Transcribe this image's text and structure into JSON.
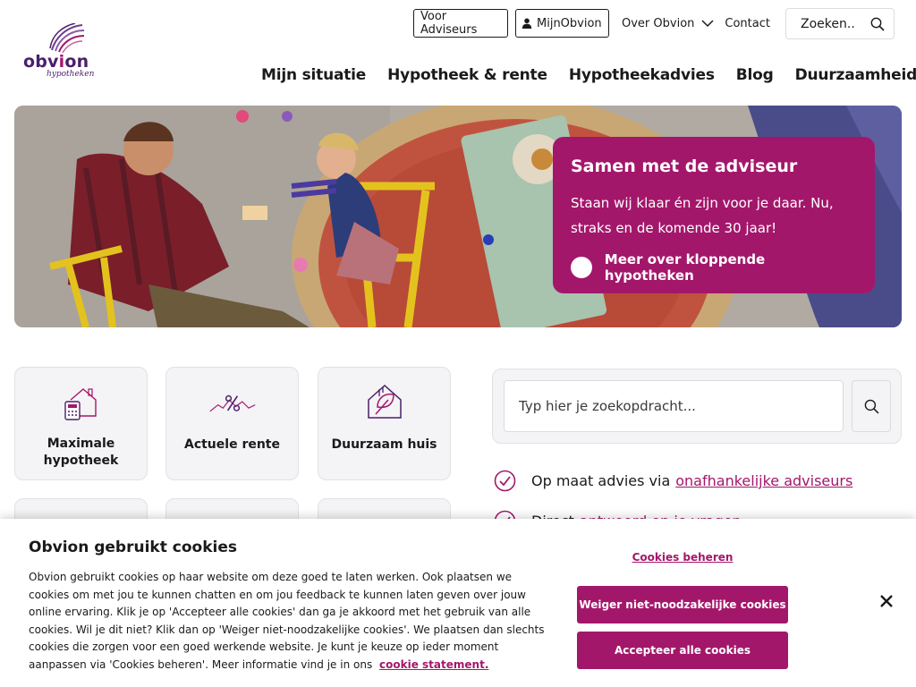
{
  "brand": {
    "name_part1": "obv",
    "name_part2": "i",
    "name_part3": "on",
    "subtitle": "hypotheken",
    "primary_color": "#a3176b",
    "dark_color": "#4a1f6b"
  },
  "top_nav": {
    "advisers_button": "Voor Adviseurs",
    "mijn_button": "MijnObvion",
    "over_link": "Over Obvion",
    "contact_link": "Contact",
    "search_label": "Zoeken.."
  },
  "main_nav": [
    "Mijn situatie",
    "Hypotheek & rente",
    "Hypotheekadvies",
    "Blog",
    "Duurzaamheid"
  ],
  "hero": {
    "title": "Samen met de adviseur",
    "text": "Staan wij klaar én zijn voor je daar. Nu, straks en de komende 30 jaar!",
    "link": "Meer over kloppende hypotheken"
  },
  "tiles": [
    {
      "label": "Maximale hypotheek",
      "icon": "house-calculator-icon"
    },
    {
      "label": "Actuele rente",
      "icon": "percent-chart-icon"
    },
    {
      "label": "Duurzaam huis",
      "icon": "sustainable-house-icon"
    }
  ],
  "search": {
    "placeholder": "Typ hier je zoekopdracht..."
  },
  "usps": [
    {
      "text": "Op maat advies via",
      "link": "onafhankelijke adviseurs"
    },
    {
      "text": "Direct",
      "link": "antwoord op je vragen"
    }
  ],
  "cookie": {
    "title": "Obvion gebruikt cookies",
    "text": "Obvion gebruikt cookies op haar website om deze goed te laten werken. Ook plaatsen we cookies om met jou te kunnen chatten en om jou feedback te kunnen laten geven over jouw online ervaring. Klik je op 'Accepteer alle cookies' dan ga je akkoord met het gebruik van alle cookies. Wil je dit niet? Klik dan op 'Weiger niet-noodzakelijke cookies'. We plaatsen dan slechts cookies die zorgen voor een goed werkende website. Je kunt je keuze op ieder moment aanpassen via 'Cookies beheren'. Meer informatie vind je in ons",
    "statement_link": "cookie statement.",
    "manage_link": "Cookies beheren",
    "reject_button": "Weiger niet-noodzakelijke cookies",
    "accept_button": "Accepteer alle cookies"
  }
}
